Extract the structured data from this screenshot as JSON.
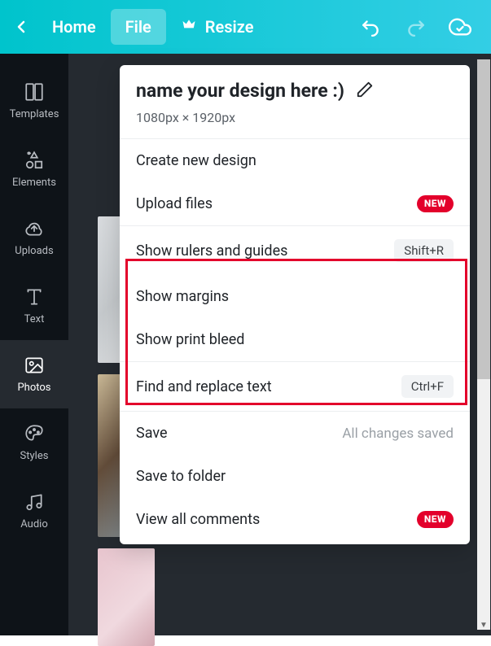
{
  "topbar": {
    "home": "Home",
    "file": "File",
    "resize": "Resize"
  },
  "sidebar": {
    "templates": "Templates",
    "elements": "Elements",
    "uploads": "Uploads",
    "text": "Text",
    "photos": "Photos",
    "styles": "Styles",
    "audio": "Audio"
  },
  "dropdown": {
    "title": "name your design here :)",
    "dimensions": "1080px × 1920px",
    "create_new": "Create new design",
    "upload_files": "Upload files",
    "badge_new": "NEW",
    "show_rulers": "Show rulers and guides",
    "show_rulers_kbd": "Shift+R",
    "show_margins": "Show margins",
    "show_bleed": "Show print bleed",
    "find_replace": "Find and replace text",
    "find_replace_kbd": "Ctrl+F",
    "save": "Save",
    "save_status": "All changes saved",
    "save_folder": "Save to folder",
    "view_comments": "View all comments"
  }
}
